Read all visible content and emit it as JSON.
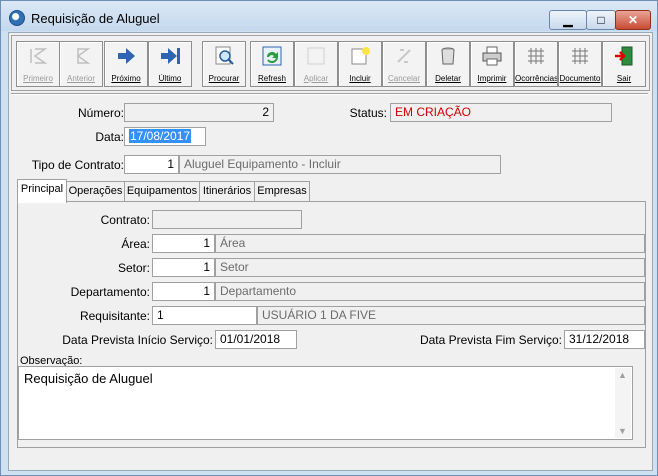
{
  "window": {
    "title": "Requisição de Aluguel"
  },
  "toolbar": {
    "buttons": [
      {
        "label": "Primeiro",
        "icon": "first-record-icon",
        "enabled": false
      },
      {
        "label": "Anterior",
        "icon": "previous-record-icon",
        "enabled": false
      },
      {
        "label": "Próximo",
        "icon": "next-record-icon",
        "enabled": true
      },
      {
        "label": "Último",
        "icon": "last-record-icon",
        "enabled": true
      },
      {
        "label": "Procurar",
        "icon": "search-icon",
        "enabled": true
      },
      {
        "label": "Refresh",
        "icon": "refresh-icon",
        "enabled": true
      },
      {
        "label": "Aplicar",
        "icon": "apply-icon",
        "enabled": false
      },
      {
        "label": "Incluir",
        "icon": "new-record-icon",
        "enabled": true
      },
      {
        "label": "Cancelar",
        "icon": "cancel-icon",
        "enabled": false
      },
      {
        "label": "Deletar",
        "icon": "trash-icon",
        "enabled": true
      },
      {
        "label": "Imprimir",
        "icon": "printer-icon",
        "enabled": true
      },
      {
        "label": "Ocorrências",
        "icon": "grid-icon",
        "enabled": true
      },
      {
        "label": "Documento",
        "icon": "grid-icon",
        "enabled": true
      },
      {
        "label": "Sair",
        "icon": "exit-door-icon",
        "enabled": true
      }
    ]
  },
  "header": {
    "numero_label": "Número:",
    "numero_value": "2",
    "status_label": "Status:",
    "status_value": "EM CRIAÇÃO",
    "data_label": "Data:",
    "data_value": "17/08/2017",
    "tipo_label": "Tipo de Contrato:",
    "tipo_code": "1",
    "tipo_desc": "Aluguel Equipamento - Incluir"
  },
  "tabs": [
    "Principal",
    "Operações",
    "Equipamentos",
    "Itinerários",
    "Empresas"
  ],
  "principal": {
    "contrato_label": "Contrato:",
    "contrato_value": "",
    "area_label": "Área:",
    "area_code": "1",
    "area_desc": "Área",
    "setor_label": "Setor:",
    "setor_code": "1",
    "setor_desc": "Setor",
    "departamento_label": "Departamento:",
    "departamento_code": "1",
    "departamento_desc": "Departamento",
    "requisitante_label": "Requisitante:",
    "requisitante_code": "1",
    "requisitante_desc": "USUÁRIO 1 DA FIVE",
    "inicio_label": "Data Prevista Início Serviço:",
    "inicio_value": "01/01/2018",
    "fim_label": "Data Prevista Fim Serviço:",
    "fim_value": "31/12/2018",
    "observacao_label": "Observação:",
    "observacao_value": "Requisição de Aluguel"
  }
}
